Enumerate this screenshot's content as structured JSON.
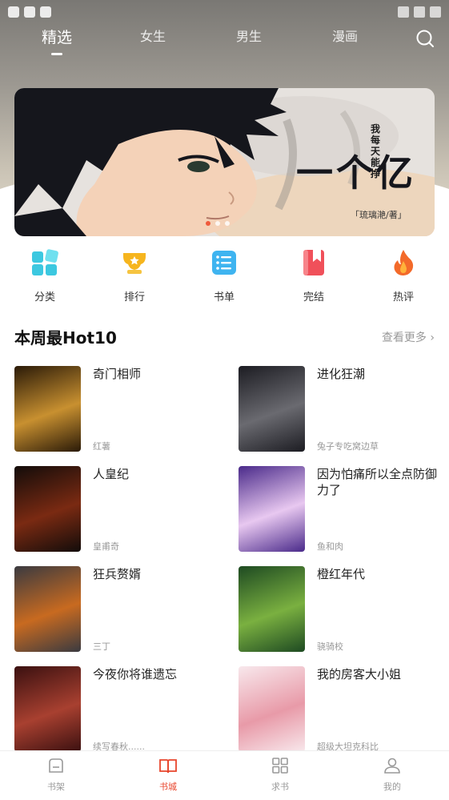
{
  "top_tabs": [
    {
      "label": "精选",
      "active": true
    },
    {
      "label": "女生",
      "active": false
    },
    {
      "label": "男生",
      "active": false
    },
    {
      "label": "漫画",
      "active": false
    }
  ],
  "search": {
    "icon": "search-icon"
  },
  "banner": {
    "title": "一个亿",
    "subtitle": "我每天能挣",
    "author_tag": "「琉璃滟/著」",
    "dots": 3,
    "active_dot": 0,
    "accent_color": "#ef5a3c"
  },
  "categories": [
    {
      "label": "分类",
      "icon": "grid-icon",
      "color": "#3cc8e0"
    },
    {
      "label": "排行",
      "icon": "trophy-icon",
      "color": "#f6b51e"
    },
    {
      "label": "书单",
      "icon": "list-icon",
      "color": "#3fb4f0"
    },
    {
      "label": "完结",
      "icon": "bookmark-icon",
      "color": "#f0505a"
    },
    {
      "label": "热评",
      "icon": "flame-icon",
      "color": "#f36a2a"
    }
  ],
  "section": {
    "title": "本周最Hot10",
    "more": "查看更多"
  },
  "books": [
    {
      "name": "奇门相师",
      "author": "红薯",
      "cover_colors": [
        "#2a1a08",
        "#c89030"
      ]
    },
    {
      "name": "进化狂潮",
      "author": "兔子专吃窝边草",
      "cover_colors": [
        "#1c1c22",
        "#6a6a70"
      ]
    },
    {
      "name": "人皇纪",
      "author": "皇甫奇",
      "cover_colors": [
        "#120c0a",
        "#7a2a12"
      ]
    },
    {
      "name": "因为怕痛所以全点防御力了",
      "author": "鱼和肉",
      "cover_colors": [
        "#4a2a8a",
        "#e8c8f0"
      ]
    },
    {
      "name": "狂兵赘婿",
      "author": "三丁",
      "cover_colors": [
        "#3a3a40",
        "#c86a20"
      ]
    },
    {
      "name": "橙红年代",
      "author": "骁骑校",
      "cover_colors": [
        "#1e4a22",
        "#7ab040"
      ]
    },
    {
      "name": "今夜你将谁遗忘",
      "author": "续写春秋......",
      "cover_colors": [
        "#3a1010",
        "#a84030"
      ]
    },
    {
      "name": "我的房客大小姐",
      "author": "超级大坦克科比",
      "cover_colors": [
        "#f8e8ec",
        "#e89aa8"
      ]
    }
  ],
  "bottom_nav": [
    {
      "label": "书架",
      "icon": "bookshelf-icon",
      "active": false
    },
    {
      "label": "书城",
      "icon": "book-open-icon",
      "active": true
    },
    {
      "label": "求书",
      "icon": "apps-icon",
      "active": false
    },
    {
      "label": "我的",
      "icon": "user-icon",
      "active": false
    }
  ],
  "colors": {
    "accent": "#e8452c",
    "muted": "#999999"
  }
}
